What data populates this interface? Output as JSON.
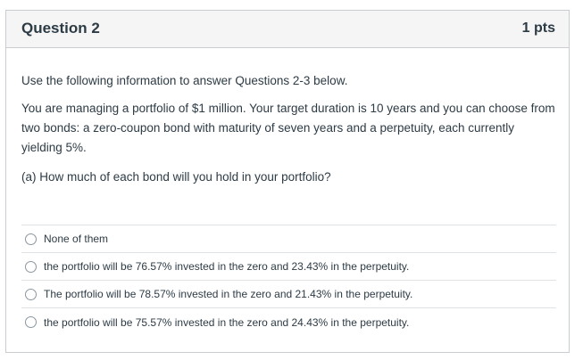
{
  "question": {
    "title": "Question 2",
    "points": "1 pts",
    "paragraphs": [
      "Use the following information to answer Questions 2-3 below.",
      "You are managing a portfolio of $1 million. Your target duration is 10 years and you can choose from two bonds: a zero-coupon bond with maturity of seven years and a perpetuity, each currently yielding 5%.",
      "(a) How much of each bond will you hold in your portfolio?"
    ]
  },
  "answers": [
    "None of them",
    "the portfolio will be 76.57% invested in the zero and 23.43% in the perpetuity.",
    "The portfolio will be 78.57% invested in the zero and 21.43% in the perpetuity.",
    "the portfolio will be 75.57% invested in the zero and 24.43% in the perpetuity."
  ]
}
